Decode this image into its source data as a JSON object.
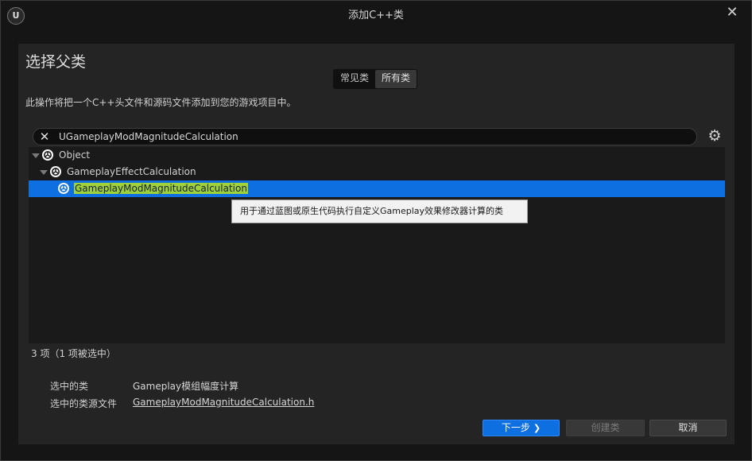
{
  "window": {
    "title": "添加C++类",
    "logo_text": "U"
  },
  "header": {
    "heading": "选择父类",
    "tabs": [
      {
        "label": "常见类",
        "active": false
      },
      {
        "label": "所有类",
        "active": true
      }
    ],
    "description": "此操作将把一个C++头文件和源码文件添加到您的游戏项目中。"
  },
  "search": {
    "value": "UGameplayModMagnitudeCalculation",
    "placeholder": ""
  },
  "tree": {
    "items": [
      {
        "label": "Object",
        "depth": 0,
        "expanded": true,
        "selected": false
      },
      {
        "label": "GameplayEffectCalculation",
        "depth": 1,
        "expanded": true,
        "selected": false
      },
      {
        "label": "GameplayModMagnitudeCalculation",
        "depth": 2,
        "expanded": false,
        "selected": true
      }
    ],
    "tooltip": "用于通过蓝图或原生代码执行自定义Gameplay效果修改器计算的类"
  },
  "status": {
    "count": "3 项（1 项被选中）"
  },
  "selection_info": {
    "class_label": "选中的类",
    "class_value": "Gameplay模组幅度计算",
    "source_label": "选中的类源文件",
    "source_value": "GameplayModMagnitudeCalculation.h"
  },
  "buttons": {
    "next": "下一步",
    "create": "创建类",
    "cancel": "取消"
  },
  "colors": {
    "selection": "#0e6fe0",
    "highlight": "#9fd23a",
    "panel": "#242424",
    "background": "#151515"
  }
}
